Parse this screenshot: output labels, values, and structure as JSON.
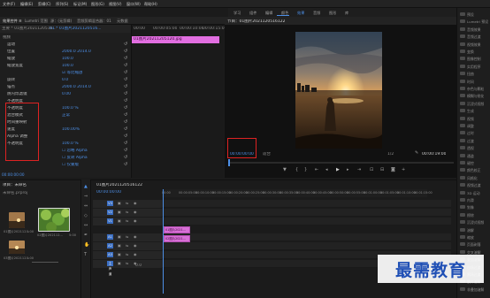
{
  "menu": [
    "文件(F)",
    "编辑(E)",
    "剪辑(C)",
    "序列(S)",
    "标记(M)",
    "图形(G)",
    "视图(V)",
    "窗口(W)",
    "帮助(H)"
  ],
  "workspace_tabs": [
    "学习",
    "组件",
    "编辑",
    "颜色",
    "效果",
    "音频",
    "图形",
    "库"
  ],
  "workspace_active": "效果",
  "panel_tabs": {
    "source": "效果控件 ≡",
    "lumetri": "Lumetri 范围",
    "source2": "源：(无剪辑)",
    "audio": "音频剪辑混合器：01",
    "meta": "元数据",
    "program": "节目：01",
    "effects": "效果 ≡"
  },
  "effect_controls": {
    "source_label": "主要 * 01图片2021120516...",
    "clip_label": "01 * 01图片2021120516...",
    "timecodes": [
      "00:00",
      "00:00:05:00",
      "00:00:10:00",
      "00:00:15:00"
    ],
    "clip_name": "01图片20211205120.jpg",
    "section": "视频",
    "rows": [
      {
        "label": "运动",
        "value": ""
      },
      {
        "label": "位置",
        "value": "2000.0   2014.0"
      },
      {
        "label": "缩放",
        "value": "100.0"
      },
      {
        "label": "缩放宽度",
        "value": "100.0"
      },
      {
        "label": "",
        "value": "☑ 等比缩放"
      },
      {
        "label": "旋转",
        "value": "0.0"
      },
      {
        "label": "锚点",
        "value": "2000.0   2014.0"
      },
      {
        "label": "防闪烁滤镜",
        "value": "0.00"
      },
      {
        "label": "不透明度",
        "value": ""
      },
      {
        "label": "不透明度",
        "value": "100.0 %"
      },
      {
        "label": "混合模式",
        "value": "正常"
      },
      {
        "label": "时间重映射",
        "value": ""
      },
      {
        "label": "速度",
        "value": "100.00%"
      },
      {
        "label": "Alpha 调整",
        "value": ""
      },
      {
        "label": "不透明度",
        "value": "100.0 %"
      },
      {
        "label": "",
        "value": "☐ 忽略 Alpha"
      },
      {
        "label": "",
        "value": "☐ 反转 Alpha"
      },
      {
        "label": "",
        "value": "☐ 仅蒙版"
      }
    ],
    "current_time": "00:00:00:00"
  },
  "program": {
    "title": "节目：01图片2021120516122",
    "timecode": "00:00:00:00",
    "fit": "适合",
    "scale": "1/2",
    "duration": "00:00:19:00"
  },
  "project": {
    "title": "项目：未命名",
    "search_placeholder": "未命名.prproj",
    "items": [
      {
        "name": "01图片202112...",
        "dur": "5:00"
      },
      {
        "name": "02图片202112...",
        "dur": "5:00"
      },
      {
        "name": "03图片202112...",
        "dur": "5:00"
      }
    ]
  },
  "timeline": {
    "title": "01图片2021120516122",
    "timecode": "00:00:00:00",
    "ruler": [
      "00:00",
      "00:00:05:00",
      "00:00:10:00",
      "00:00:15:00",
      "00:00:20:00",
      "00:00:25:00",
      "00:00:30:00",
      "00:00:35:00",
      "00:00:40:00",
      "00:00:45:00",
      "00:00:50:00",
      "00:00:55:00",
      "00:01:00:00",
      "00:01:05:00",
      "00:01:10:00",
      "00:01:15:00"
    ],
    "tracks": [
      "V3",
      "V2",
      "V1",
      "A1",
      "A2",
      "A3",
      "主声道"
    ],
    "master_value": "0.0",
    "clips": [
      "01图片2021...",
      "02图片2021..."
    ]
  },
  "right_panel": {
    "items": [
      "预设",
      "Lumetri 预设",
      "音频效果",
      "音频过渡",
      "视频效果",
      "变换",
      "图像控制",
      "实用程序",
      "扭曲",
      "时间",
      "杂色与颗粒",
      "模糊与锐化",
      "沉浸式视频",
      "生成",
      "视频",
      "调整",
      "过时",
      "过渡",
      "透视",
      "通道",
      "键控",
      "颜色校正",
      "风格化",
      "视频过渡",
      "3D 运动",
      "内滑",
      "划像",
      "擦除",
      "沉浸式视频",
      "溶解",
      "缩放",
      "页面剥落",
      "交叉溶解",
      "叠加溶解",
      "白场过渡",
      "黑场过渡",
      "胶片溶解",
      "非叠加溶解"
    ]
  },
  "watermark": "最需教育"
}
